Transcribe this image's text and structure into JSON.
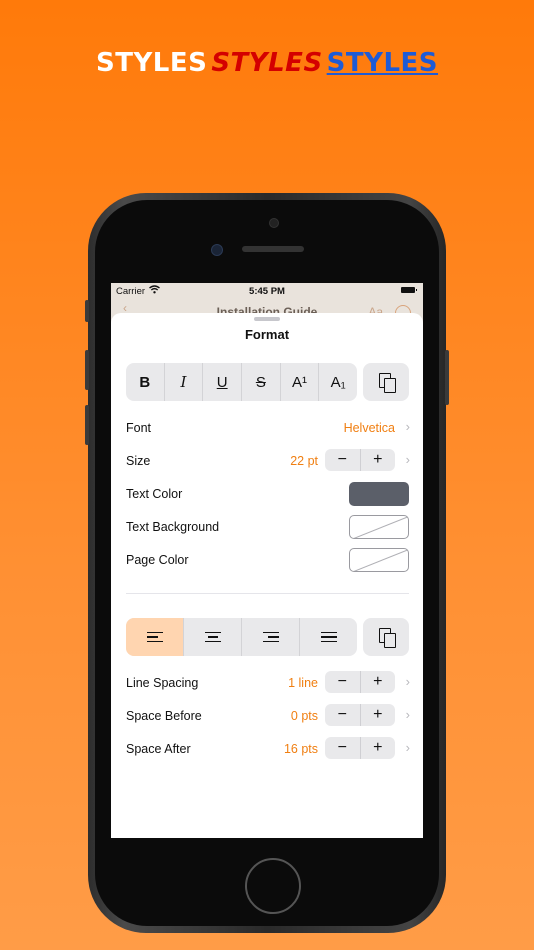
{
  "headline": {
    "word1": "STYLES",
    "word2": "STYLES",
    "word3": "STYLES"
  },
  "colors": {
    "accent": "#f07f12",
    "bg_top": "#ff7a0a",
    "bg_bottom": "#ff9c47",
    "text_color_swatch": "#5b5f69",
    "active_segment": "#ffd5b0"
  },
  "statusbar": {
    "carrier": "Carrier",
    "time": "5:45 PM",
    "wifi_icon": "wifi-icon",
    "battery_icon": "battery-icon"
  },
  "navbar": {
    "title": "Installation Guide",
    "aa_label": "Aa"
  },
  "sheet": {
    "title": "Format",
    "style_buttons": [
      "B",
      "I",
      "U",
      "S",
      "A¹",
      "A₁"
    ],
    "rows": {
      "font": {
        "label": "Font",
        "value": "Helvetica"
      },
      "size": {
        "label": "Size",
        "value": "22 pt"
      },
      "text_color": {
        "label": "Text Color"
      },
      "text_background": {
        "label": "Text Background"
      },
      "page_color": {
        "label": "Page Color"
      },
      "line_spacing": {
        "label": "Line Spacing",
        "value": "1 line"
      },
      "space_before": {
        "label": "Space Before",
        "value": "0 pts"
      },
      "space_after": {
        "label": "Space After",
        "value": "16 pts"
      }
    },
    "stepper": {
      "minus": "−",
      "plus": "+"
    },
    "chevron": "›",
    "alignment_selected": "left"
  }
}
